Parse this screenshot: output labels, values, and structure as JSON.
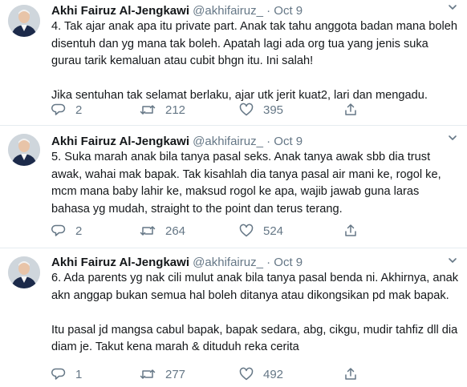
{
  "tweets": [
    {
      "author_name": "Akhi Fairuz Al-Jengkawi",
      "handle": "@akhifairuz_",
      "separator": "·",
      "date": "Oct 9",
      "text": "4. Tak ajar anak apa itu private part. Anak tak tahu anggota badan mana boleh disentuh dan yg mana tak boleh. Apatah lagi ada org tua yang jenis suka gurau tarik kemaluan atau cubit bhgn itu. Ini salah!\n\nJika sentuhan tak selamat berlaku, ajar utk jerit kuat2, lari dan mengadu.",
      "replies": "2",
      "retweets": "212",
      "likes": "395"
    },
    {
      "author_name": "Akhi Fairuz Al-Jengkawi",
      "handle": "@akhifairuz_",
      "separator": "·",
      "date": "Oct 9",
      "text": "5. Suka marah anak bila tanya pasal seks. Anak tanya awak sbb dia trust awak, wahai mak bapak. Tak kisahlah dia tanya pasal air mani ke, rogol ke, mcm mana baby lahir ke, maksud rogol ke apa, wajib jawab guna laras bahasa yg mudah, straight to the point dan terus terang.",
      "replies": "2",
      "retweets": "264",
      "likes": "524"
    },
    {
      "author_name": "Akhi Fairuz Al-Jengkawi",
      "handle": "@akhifairuz_",
      "separator": "·",
      "date": "Oct 9",
      "text": "6. Ada parents yg nak cili mulut anak bila tanya pasal benda ni. Akhirnya, anak akn anggap bukan semua hal boleh ditanya atau dikongsikan pd mak bapak.\n\nItu pasal jd mangsa cabul bapak, bapak sedara, abg, cikgu, mudir tahfiz dll dia diam je. Takut kena marah & dituduh reka cerita",
      "replies": "1",
      "retweets": "277",
      "likes": "492"
    }
  ],
  "icons": {
    "reply": "reply-icon",
    "retweet": "retweet-icon",
    "like": "heart-icon",
    "share": "share-icon",
    "more": "chevron-down-icon"
  },
  "colors": {
    "text": "#14171a",
    "secondary": "#657786",
    "divider": "#e6ecf0"
  }
}
